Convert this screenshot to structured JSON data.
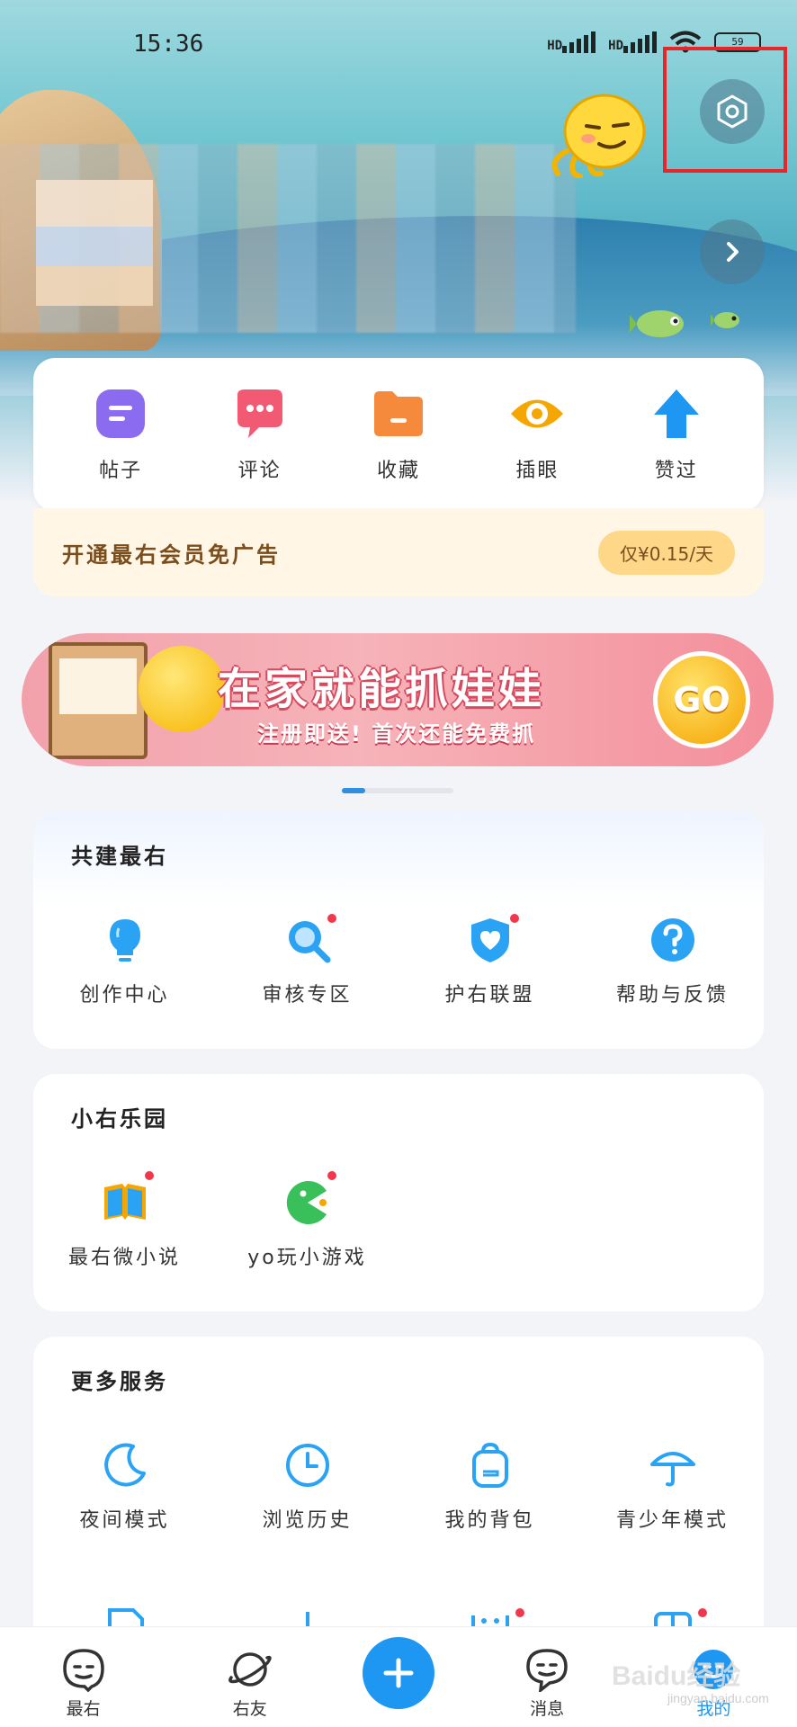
{
  "status_bar": {
    "time": "15:36",
    "signal1": "HD",
    "signal2": "HD",
    "battery": "59"
  },
  "quick": [
    {
      "label": "帖子",
      "icon": "post-icon",
      "color": "#8b6cf0"
    },
    {
      "label": "评论",
      "icon": "comment-icon",
      "color": "#f25a73"
    },
    {
      "label": "收藏",
      "icon": "folder-icon",
      "color": "#f58a3c"
    },
    {
      "label": "插眼",
      "icon": "eye-icon",
      "color": "#f6a600"
    },
    {
      "label": "赞过",
      "icon": "thumb-arrow-icon",
      "color": "#1e97f2"
    }
  ],
  "vip": {
    "text": "开通最右会员免广告",
    "price": "仅¥0.15/天"
  },
  "banner": {
    "title": "在家就能抓娃娃",
    "subtitle": "注册即送! 首次还能免费抓",
    "go": "GO"
  },
  "section1": {
    "title": "共建最右",
    "items": [
      {
        "label": "创作中心",
        "icon": "bulb-icon"
      },
      {
        "label": "审核专区",
        "icon": "magnifier-icon"
      },
      {
        "label": "护右联盟",
        "icon": "shield-heart-icon"
      },
      {
        "label": "帮助与反馈",
        "icon": "help-icon"
      }
    ]
  },
  "section2": {
    "title": "小右乐园",
    "items": [
      {
        "label": "最右微小说",
        "icon": "book-icon"
      },
      {
        "label": "yo玩小游戏",
        "icon": "game-icon"
      }
    ]
  },
  "section3": {
    "title": "更多服务",
    "items": [
      {
        "label": "夜间模式",
        "icon": "moon-icon"
      },
      {
        "label": "浏览历史",
        "icon": "clock-icon"
      },
      {
        "label": "我的背包",
        "icon": "backpack-icon"
      },
      {
        "label": "青少年模式",
        "icon": "umbrella-icon"
      }
    ]
  },
  "nav": [
    {
      "label": "最右",
      "icon": "home-face-icon"
    },
    {
      "label": "右友",
      "icon": "planet-icon"
    },
    {
      "label": "消息",
      "icon": "message-icon"
    },
    {
      "label": "我的",
      "icon": "profile-icon"
    }
  ],
  "accent": "#1e97f2",
  "watermark": {
    "brand": "Baidu经验",
    "url": "jingyan.baidu.com"
  }
}
